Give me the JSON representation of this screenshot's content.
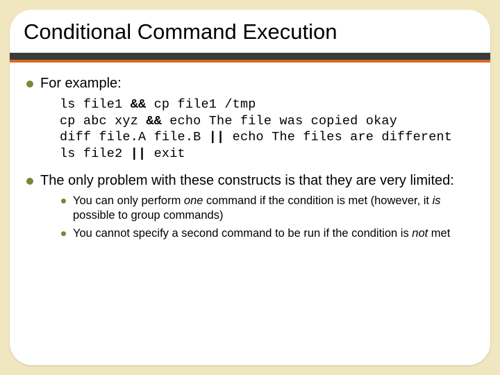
{
  "title": "Conditional Command Execution",
  "bullets": {
    "one": {
      "label": "For example:"
    },
    "two": {
      "label": "The only problem with these constructs is that they are very limited:"
    }
  },
  "code": {
    "l1a": "ls file1 ",
    "l1b": "&&",
    "l1c": " cp file1 /tmp",
    "l2a": "cp abc xyz ",
    "l2b": "&&",
    "l2c": " echo The file was copied okay",
    "l3a": "diff file.A file.B ",
    "l3b": "||",
    "l3c": " echo The files are different",
    "l4a": "ls file2 ",
    "l4b": "||",
    "l4c": " exit"
  },
  "sub": {
    "s1a": "You can only perform ",
    "s1b": "one",
    "s1c": " command if the condition is met (however, it ",
    "s1d": "is",
    "s1e": " possible to group commands)",
    "s2a": "You cannot specify a second command to be run if the condition is ",
    "s2b": "not",
    "s2c": " met"
  }
}
